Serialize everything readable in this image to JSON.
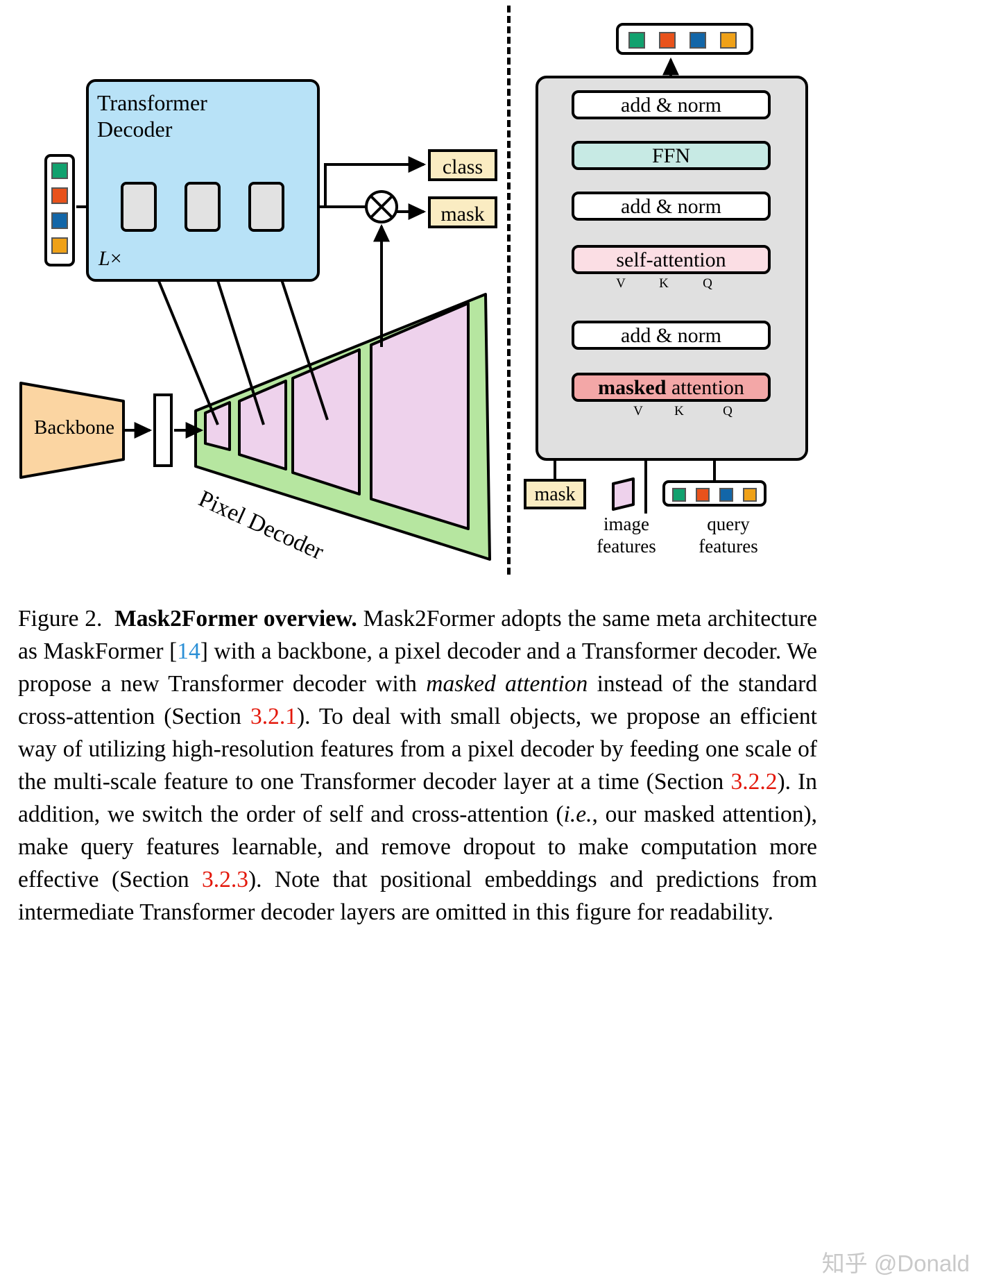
{
  "figure": {
    "left_panel": {
      "transformer_decoder_title": "Transformer\nDecoder",
      "repeat_label": "L",
      "repeat_times": "×",
      "backbone_label": "Backbone",
      "pixel_decoder_label": "Pixel Decoder",
      "outputs": {
        "class_label": "class",
        "mask_label": "mask"
      },
      "query_colors": [
        "#11a16e",
        "#e8521b",
        "#1266a8",
        "#efa118"
      ]
    },
    "right_panel": {
      "stages": [
        {
          "id": "add-norm-1",
          "label": "add & norm",
          "color": "#ffffff"
        },
        {
          "id": "ffn",
          "label": "FFN",
          "color": "#c7eae4"
        },
        {
          "id": "add-norm-2",
          "label": "add & norm",
          "color": "#ffffff"
        },
        {
          "id": "self-attention",
          "label": "self-attention",
          "color": "#fbdee4"
        },
        {
          "id": "add-norm-3",
          "label": "add & norm",
          "color": "#ffffff"
        },
        {
          "id": "masked-attention",
          "label_bold": "masked",
          "label_rest": " attention",
          "color": "#f3a7a7"
        }
      ],
      "vkq_labels": [
        "V",
        "K",
        "Q"
      ],
      "mask_input_label": "mask",
      "image_features_label": "image\nfeatures",
      "query_features_label": "query\nfeatures",
      "query_colors": [
        "#11a16e",
        "#e8521b",
        "#1266a8",
        "#efa118"
      ]
    }
  },
  "caption": {
    "figure_number": "Figure 2.",
    "title": "Mask2Former overview.",
    "body_1": " Mask2Former adopts the same meta architecture as MaskFormer ",
    "cite_open": "[",
    "cite_num": "14",
    "cite_close": "]",
    "body_2": " with a backbone, a pixel decoder and a Transformer decoder. We propose a new Transformer decoder with ",
    "italic_1": "masked attention",
    "body_3": " instead of the standard cross-attention (Section ",
    "secref_1": "3.2.1",
    "body_4": "). To deal with small objects, we propose an efficient way of utilizing high-resolution features from a pixel decoder by feeding one scale of the multi-scale feature to one Transformer decoder layer at a time (Section ",
    "secref_2": "3.2.2",
    "body_5": "). In addition, we switch the order of self and cross-attention (",
    "italic_2": "i.e.",
    "body_6": ", our masked attention), make query features learnable, and remove dropout to make computation more effective (Section ",
    "secref_3": "3.2.3",
    "body_7": "). Note that positional embeddings and predictions from intermediate Transformer decoder layers are omitted in this figure for readability."
  },
  "watermark": {
    "text": "知乎 @Donald"
  }
}
